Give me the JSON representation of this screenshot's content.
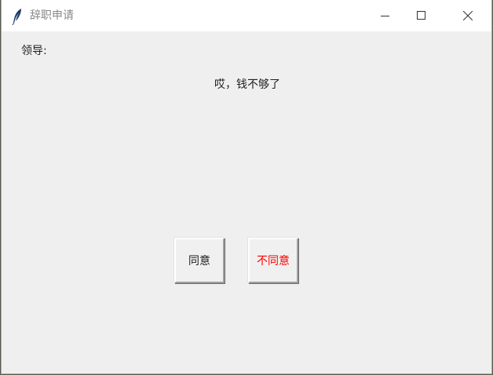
{
  "window": {
    "title": "辞职申请",
    "icon": "feather-icon"
  },
  "titlebar_controls": {
    "minimize_icon": "minimize-icon",
    "maximize_icon": "maximize-icon",
    "close_icon": "close-icon"
  },
  "content": {
    "leader_label": "领导:",
    "message": "哎，钱不够了",
    "agree_label": "同意",
    "disagree_label": "不同意"
  },
  "colors": {
    "background": "#efefef",
    "disagree_text": "#ff0000",
    "title_text": "#888888"
  }
}
